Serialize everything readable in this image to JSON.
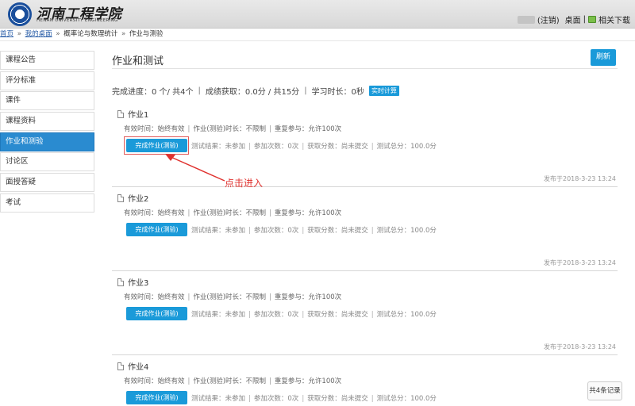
{
  "header": {
    "logo_title": "河南工程学院",
    "logo_sub": "HENAN UNIVERSITY ENGINEERING",
    "logout": "(注销)",
    "desktop": "桌面",
    "separator": "|",
    "download": "相关下载"
  },
  "breadcrumb": {
    "home": "首页",
    "desk": "我的桌面",
    "course": "概率论与数理统计",
    "current": "作业与测验",
    "sep": "»"
  },
  "sidebar": {
    "items": [
      {
        "label": "课程公告"
      },
      {
        "label": "评分标准"
      },
      {
        "label": "课件"
      },
      {
        "label": "课程资料"
      },
      {
        "label": "作业和测验"
      },
      {
        "label": "讨论区"
      },
      {
        "label": "面授答疑"
      },
      {
        "label": "考试"
      }
    ]
  },
  "main": {
    "title": "作业和测试",
    "refresh": "刷新",
    "progress_text": "完成进度：0 个/ 共4个",
    "score_text": "成绩获取：0.0分 / 共15分",
    "time_text": "学习时长：0秒",
    "pipe": "|",
    "realtime": "实时计算"
  },
  "homeworks": [
    {
      "title": "作业1",
      "valid": "有效时间：始终有效",
      "duration": "作业(测验)时长：不限制",
      "repeat": "重复参与：允许100次",
      "button": "完成作业(测验)",
      "result": "测试结果：未参加",
      "attempts": "参加次数：0次",
      "score": "获取分数：尚未提交",
      "total": "测试总分：100.0分",
      "date": "发布于2018-3-23 13:24"
    },
    {
      "title": "作业2",
      "valid": "有效时间：始终有效",
      "duration": "作业(测验)时长：不限制",
      "repeat": "重复参与：允许100次",
      "button": "完成作业(测验)",
      "result": "测试结果：未参加",
      "attempts": "参加次数：0次",
      "score": "获取分数：尚未提交",
      "total": "测试总分：100.0分",
      "date": "发布于2018-3-23 13:24"
    },
    {
      "title": "作业3",
      "valid": "有效时间：始终有效",
      "duration": "作业(测验)时长：不限制",
      "repeat": "重复参与：允许100次",
      "button": "完成作业(测验)",
      "result": "测试结果：未参加",
      "attempts": "参加次数：0次",
      "score": "获取分数：尚未提交",
      "total": "测试总分：100.0分",
      "date": "发布于2018-3-23 13:24"
    },
    {
      "title": "作业4",
      "valid": "有效时间：始终有效",
      "duration": "作业(测验)时长：不限制",
      "repeat": "重复参与：允许100次",
      "button": "完成作业(测验)",
      "result": "测试结果：未参加",
      "attempts": "参加次数：0次",
      "score": "获取分数：尚未提交",
      "total": "测试总分：100.0分",
      "date": ""
    }
  ],
  "annotation": {
    "text": "点击进入",
    "color": "#e0322f"
  },
  "pagination": {
    "total": "共4条记录"
  },
  "colors": {
    "accent": "#1a9ad9",
    "active_nav": "#2a8bd0"
  }
}
